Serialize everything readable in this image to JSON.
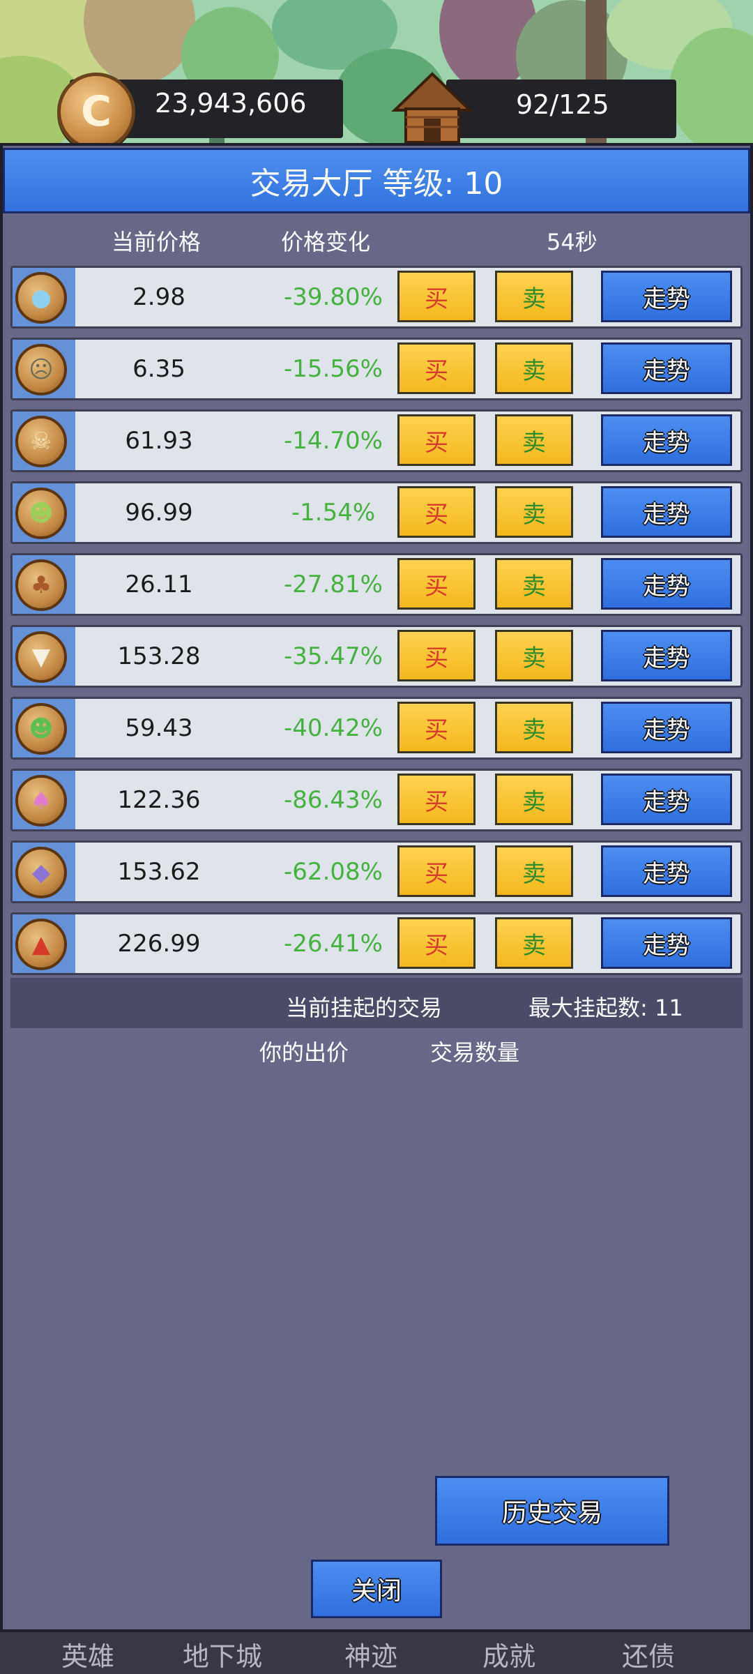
{
  "top_bar": {
    "coins": "23,943,606",
    "coin_icon": "coin-c-icon",
    "capacity": "92/125",
    "house_icon": "house-icon"
  },
  "panel": {
    "title": "交易大厅 等级: 10",
    "col_price": "当前价格",
    "col_change": "价格变化",
    "timer": "54秒"
  },
  "rows": [
    {
      "icon": "slime-icon",
      "price": "2.98",
      "change": "-39.80%",
      "buy": "买",
      "sell": "卖",
      "trend": "走势"
    },
    {
      "icon": "zombie-icon",
      "price": "6.35",
      "change": "-15.56%",
      "buy": "买",
      "sell": "卖",
      "trend": "走势"
    },
    {
      "icon": "skull-icon",
      "price": "61.93",
      "change": "-14.70%",
      "buy": "买",
      "sell": "卖",
      "trend": "走势"
    },
    {
      "icon": "goblin-icon",
      "price": "96.99",
      "change": "-1.54%",
      "buy": "买",
      "sell": "卖",
      "trend": "走势"
    },
    {
      "icon": "treant-icon",
      "price": "26.11",
      "change": "-27.81%",
      "buy": "买",
      "sell": "卖",
      "trend": "走势"
    },
    {
      "icon": "wolf-icon",
      "price": "153.28",
      "change": "-35.47%",
      "buy": "买",
      "sell": "卖",
      "trend": "走势"
    },
    {
      "icon": "orc-icon",
      "price": "59.43",
      "change": "-40.42%",
      "buy": "买",
      "sell": "卖",
      "trend": "走势"
    },
    {
      "icon": "mushroom-icon",
      "price": "122.36",
      "change": "-86.43%",
      "buy": "买",
      "sell": "卖",
      "trend": "走势"
    },
    {
      "icon": "bat-icon",
      "price": "153.62",
      "change": "-62.08%",
      "buy": "买",
      "sell": "卖",
      "trend": "走势"
    },
    {
      "icon": "dragon-icon",
      "price": "226.99",
      "change": "-26.41%",
      "buy": "买",
      "sell": "卖",
      "trend": "走势"
    }
  ],
  "pending": {
    "title": "当前挂起的交易",
    "max": "最大挂起数: 11",
    "col_bid": "你的出价",
    "col_qty": "交易数量"
  },
  "buttons": {
    "history": "历史交易",
    "close": "关闭"
  },
  "nav": [
    "英雄",
    "地下城",
    "神迹",
    "成就",
    "还债"
  ],
  "colors": {
    "panel_bg": "#676888",
    "header_blue": "#3f80e8",
    "buy_sell_yellow": "#f8c435",
    "change_green": "#45b240"
  }
}
